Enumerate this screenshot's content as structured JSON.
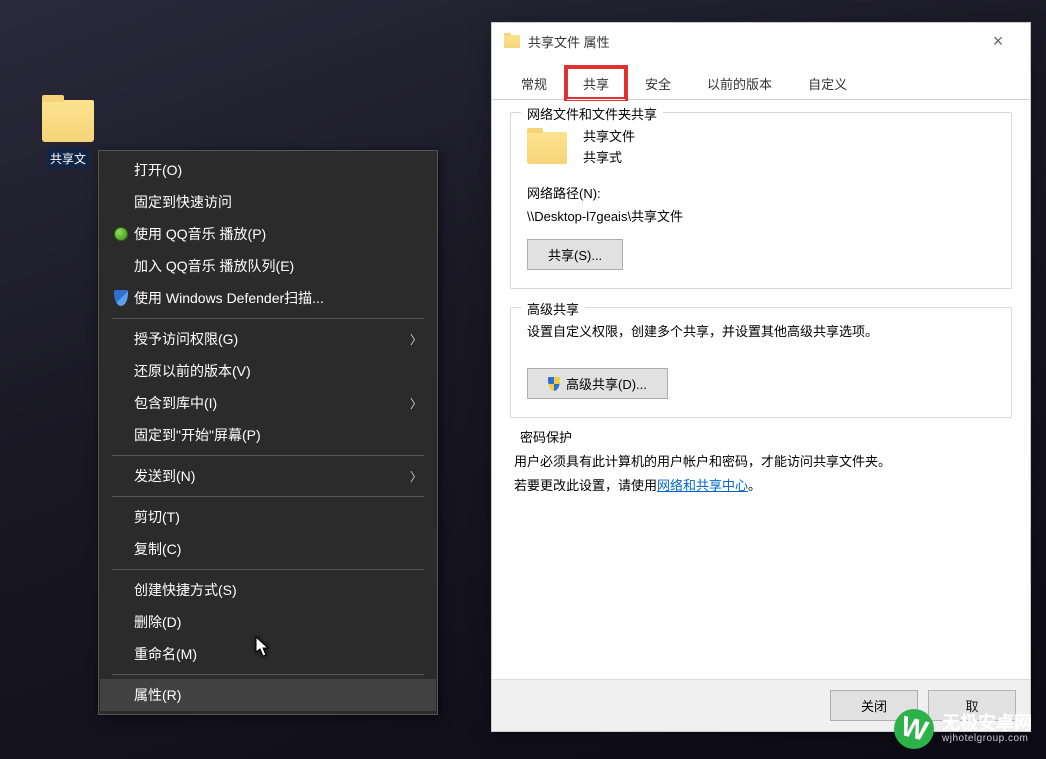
{
  "desktop": {
    "icon_label": "共享文"
  },
  "context_menu": {
    "items": [
      {
        "label": "打开(O)",
        "icon": null,
        "arrow": false
      },
      {
        "label": "固定到快速访问",
        "icon": null,
        "arrow": false
      },
      {
        "label": "使用 QQ音乐 播放(P)",
        "icon": "qq",
        "arrow": false
      },
      {
        "label": "加入 QQ音乐 播放队列(E)",
        "icon": null,
        "arrow": false
      },
      {
        "label": "使用 Windows Defender扫描...",
        "icon": "shield",
        "arrow": false
      }
    ],
    "items2": [
      {
        "label": "授予访问权限(G)",
        "arrow": true
      },
      {
        "label": "还原以前的版本(V)",
        "arrow": false
      },
      {
        "label": "包含到库中(I)",
        "arrow": true
      },
      {
        "label": "固定到\"开始\"屏幕(P)",
        "arrow": false
      }
    ],
    "items3": [
      {
        "label": "发送到(N)",
        "arrow": true
      }
    ],
    "items4": [
      {
        "label": "剪切(T)",
        "arrow": false
      },
      {
        "label": "复制(C)",
        "arrow": false
      }
    ],
    "items5": [
      {
        "label": "创建快捷方式(S)",
        "arrow": false
      },
      {
        "label": "删除(D)",
        "arrow": false
      },
      {
        "label": "重命名(M)",
        "arrow": false
      }
    ],
    "items6": [
      {
        "label": "属性(R)",
        "arrow": false,
        "hover": true
      }
    ]
  },
  "dialog": {
    "title": "共享文件 属性",
    "tabs": {
      "general": "常规",
      "share": "共享",
      "security": "安全",
      "previous": "以前的版本",
      "custom": "自定义"
    },
    "network_share": {
      "legend": "网络文件和文件夹共享",
      "name": "共享文件",
      "status": "共享式",
      "path_label": "网络路径(N):",
      "path": "\\\\Desktop-l7geais\\共享文件",
      "share_btn": "共享(S)..."
    },
    "advanced": {
      "legend": "高级共享",
      "desc": "设置自定义权限，创建多个共享，并设置其他高级共享选项。",
      "btn": "高级共享(D)..."
    },
    "password": {
      "legend": "密码保护",
      "line1": "用户必须具有此计算机的用户帐户和密码，才能访问共享文件夹。",
      "line2a": "若要更改此设置，请使用",
      "link": "网络和共享中心",
      "line2b": "。"
    },
    "footer": {
      "close": "关闭",
      "cancel": "取"
    }
  },
  "watermark": {
    "title": "无极安卓网",
    "sub": "wjhotelgroup.com"
  }
}
